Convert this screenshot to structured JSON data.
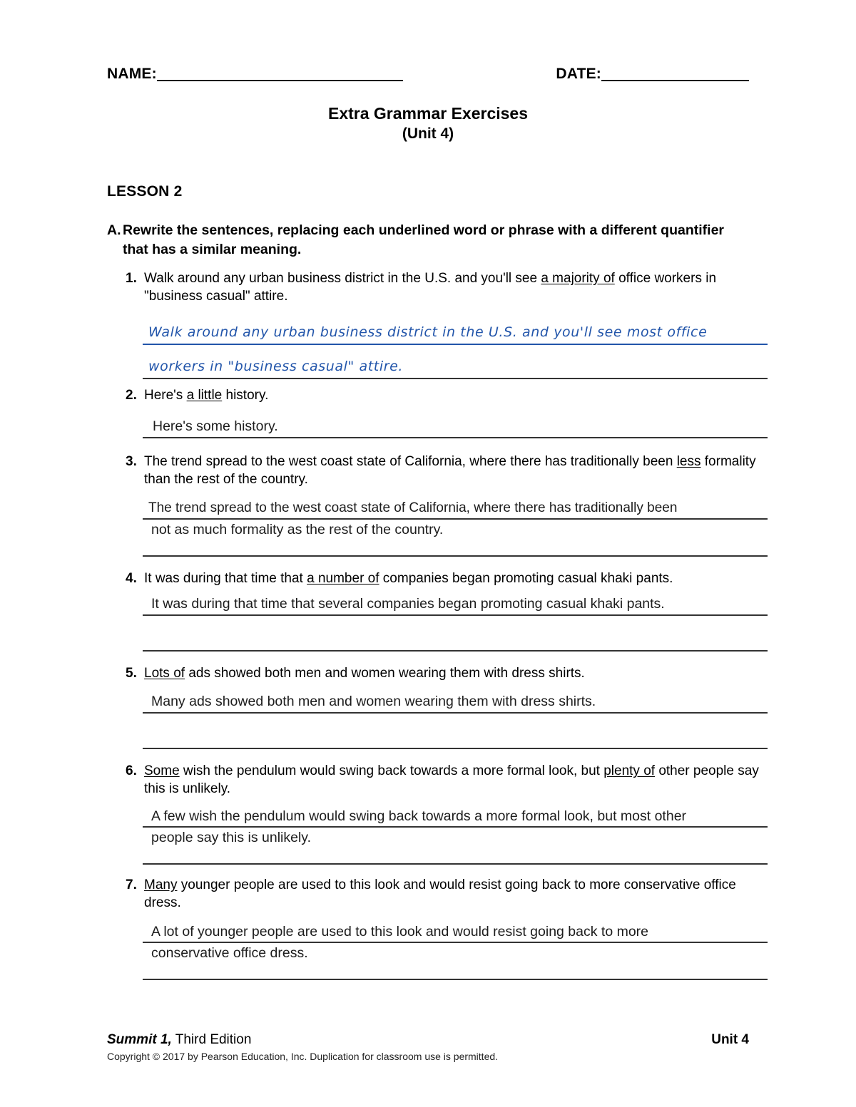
{
  "header": {
    "name_label": "NAME:",
    "date_label": "DATE:"
  },
  "title": "Extra Grammar Exercises",
  "subtitle": "(Unit 4)",
  "lesson_heading": "LESSON 2",
  "instruction": {
    "letter": "A.",
    "text": "Rewrite the sentences, replacing each underlined word or phrase with a different quantifier that has a similar meaning."
  },
  "exercises": [
    {
      "num": "1.",
      "prompt_pre": "Walk around any urban business district in the U.S. and you'll see ",
      "prompt_underlined": "a majority of",
      "prompt_post": " office workers in \"business casual\" attire.",
      "answer_style": "handwritten",
      "answer_line1": "Walk around any urban business district in the U.S. and you'll see most office",
      "answer_line2": "workers in \"business casual\" attire."
    },
    {
      "num": "2.",
      "prompt_pre": "Here's ",
      "prompt_underlined": "a little",
      "prompt_post": " history.",
      "answer_style": "typed",
      "answer_line1": "Here's some history.",
      "answer_line2": ""
    },
    {
      "num": "3.",
      "prompt_pre": "The trend spread to the west coast state of California, where there has traditionally been ",
      "prompt_underlined": "less",
      "prompt_post": " formality than the rest of the country.",
      "answer_style": "typed",
      "answer_line1": "The trend spread to the west coast state of California, where there has traditionally been",
      "answer_line2": "not as much formality as the rest of the country."
    },
    {
      "num": "4.",
      "prompt_pre": "It was during that time that ",
      "prompt_underlined": "a number of",
      "prompt_post": " companies began promoting casual khaki pants.",
      "answer_style": "typed",
      "answer_line1": "It was during that time that several companies began promoting casual khaki pants.",
      "answer_line2": ""
    },
    {
      "num": "5.",
      "prompt_pre": "",
      "prompt_underlined": "Lots of",
      "prompt_post": " ads showed both men and women wearing them with dress shirts.",
      "answer_style": "typed",
      "answer_line1": "Many ads showed both men and women wearing them with dress shirts.",
      "answer_line2": ""
    },
    {
      "num": "6.",
      "prompt_pre": "",
      "prompt_underlined": "Some",
      "prompt_mid": " wish the pendulum would swing back towards a more formal look, but ",
      "prompt_underlined2": "plenty of",
      "prompt_post": " other people say this is unlikely.",
      "answer_style": "typed",
      "answer_line1": "A few wish the pendulum would swing back towards a more formal look, but most other",
      "answer_line2": "people say this is unlikely."
    },
    {
      "num": "7.",
      "prompt_pre": "",
      "prompt_underlined": "Many",
      "prompt_post": " younger people are used to this look and would resist going back to more conservative office dress.",
      "answer_style": "typed",
      "answer_line1": "A lot of younger people are used to this look and would resist going back to more",
      "answer_line2": "conservative office dress."
    }
  ],
  "footer": {
    "book_title": "Summit 1,",
    "edition": " Third Edition",
    "unit": "Unit 4",
    "copyright": "Copyright © 2017 by Pearson Education, Inc. Duplication for classroom use is permitted."
  },
  "colors": {
    "handwriting_blue": "#2255aa",
    "rule": "#333333",
    "text": "#000000"
  }
}
